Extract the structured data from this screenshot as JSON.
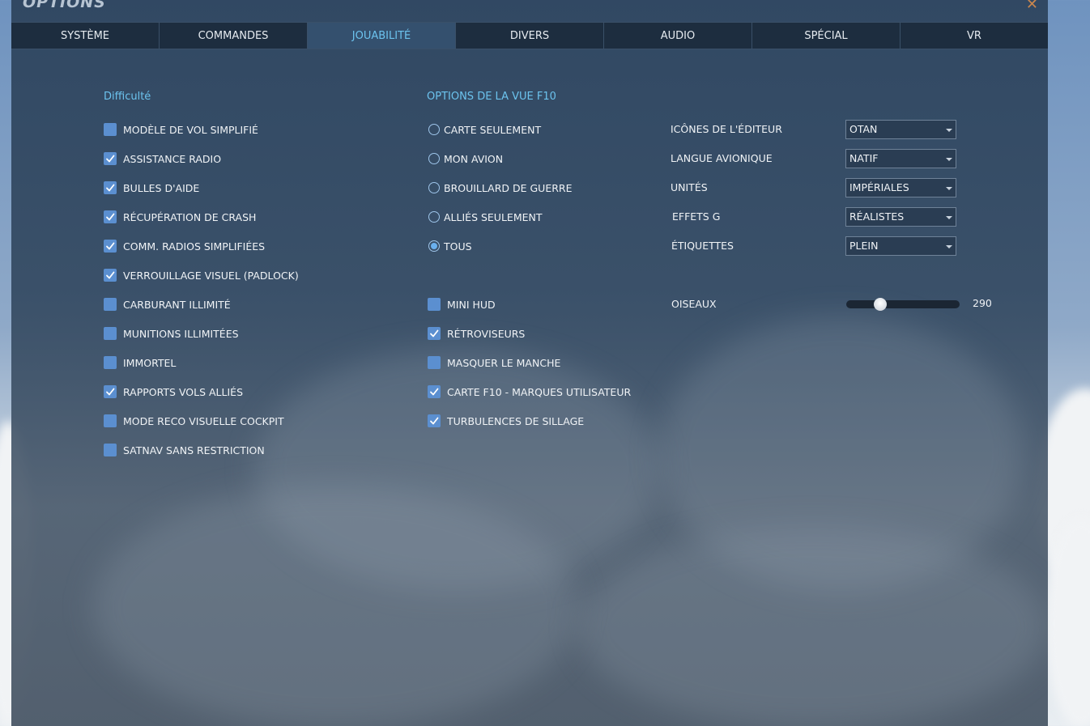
{
  "window": {
    "title": "OPTIONS"
  },
  "tabs": [
    {
      "label": "SYSTÈME",
      "active": false
    },
    {
      "label": "COMMANDES",
      "active": false
    },
    {
      "label": "JOUABILITÉ",
      "active": true
    },
    {
      "label": "DIVERS",
      "active": false
    },
    {
      "label": "AUDIO",
      "active": false
    },
    {
      "label": "SPÉCIAL",
      "active": false
    },
    {
      "label": "VR",
      "active": false
    }
  ],
  "difficulty": {
    "title": "Difficulté",
    "items": [
      {
        "label": "MODÈLE DE VOL SIMPLIFIÉ",
        "checked": false
      },
      {
        "label": "ASSISTANCE RADIO",
        "checked": true
      },
      {
        "label": "BULLES D'AIDE",
        "checked": true
      },
      {
        "label": "RÉCUPÉRATION DE CRASH",
        "checked": true
      },
      {
        "label": "COMM. RADIOS SIMPLIFIÉES",
        "checked": true
      },
      {
        "label": "VERROUILLAGE VISUEL (PADLOCK)",
        "checked": true
      },
      {
        "label": "CARBURANT ILLIMITÉ",
        "checked": false
      },
      {
        "label": "MUNITIONS ILLIMITÉES",
        "checked": false
      },
      {
        "label": "IMMORTEL",
        "checked": false
      },
      {
        "label": "RAPPORTS VOLS ALLIÉS",
        "checked": true
      },
      {
        "label": "MODE RECO VISUELLE COCKPIT",
        "checked": false
      },
      {
        "label": "SATNAV SANS RESTRICTION",
        "checked": false
      }
    ]
  },
  "f10_view": {
    "title": "OPTIONS DE LA VUE F10",
    "radios": [
      {
        "label": "CARTE SEULEMENT",
        "selected": false
      },
      {
        "label": "MON AVION",
        "selected": false
      },
      {
        "label": "BROUILLARD DE GUERRE",
        "selected": false
      },
      {
        "label": "ALLIÉS SEULEMENT",
        "selected": false
      },
      {
        "label": "TOUS",
        "selected": true
      }
    ]
  },
  "misc_checks": [
    {
      "label": "MINI HUD",
      "checked": false
    },
    {
      "label": "RÉTROVISEURS",
      "checked": true
    },
    {
      "label": "MASQUER LE MANCHE",
      "checked": false
    },
    {
      "label": "CARTE F10 - MARQUES UTILISATEUR",
      "checked": true
    },
    {
      "label": "TURBULENCES DE SILLAGE",
      "checked": true
    }
  ],
  "settings": [
    {
      "label": "ICÔNES DE L'ÉDITEUR",
      "value": "OTAN"
    },
    {
      "label": "LANGUE AVIONIQUE",
      "value": "NATIF"
    },
    {
      "label": "UNITÉS",
      "value": "IMPÉRIALES"
    },
    {
      "label": "EFFETS G",
      "value": "RÉALISTES"
    },
    {
      "label": "ÉTIQUETTES",
      "value": "PLEIN"
    }
  ],
  "birds": {
    "label": "OISEAUX",
    "value": "290",
    "fraction": 0.3
  }
}
